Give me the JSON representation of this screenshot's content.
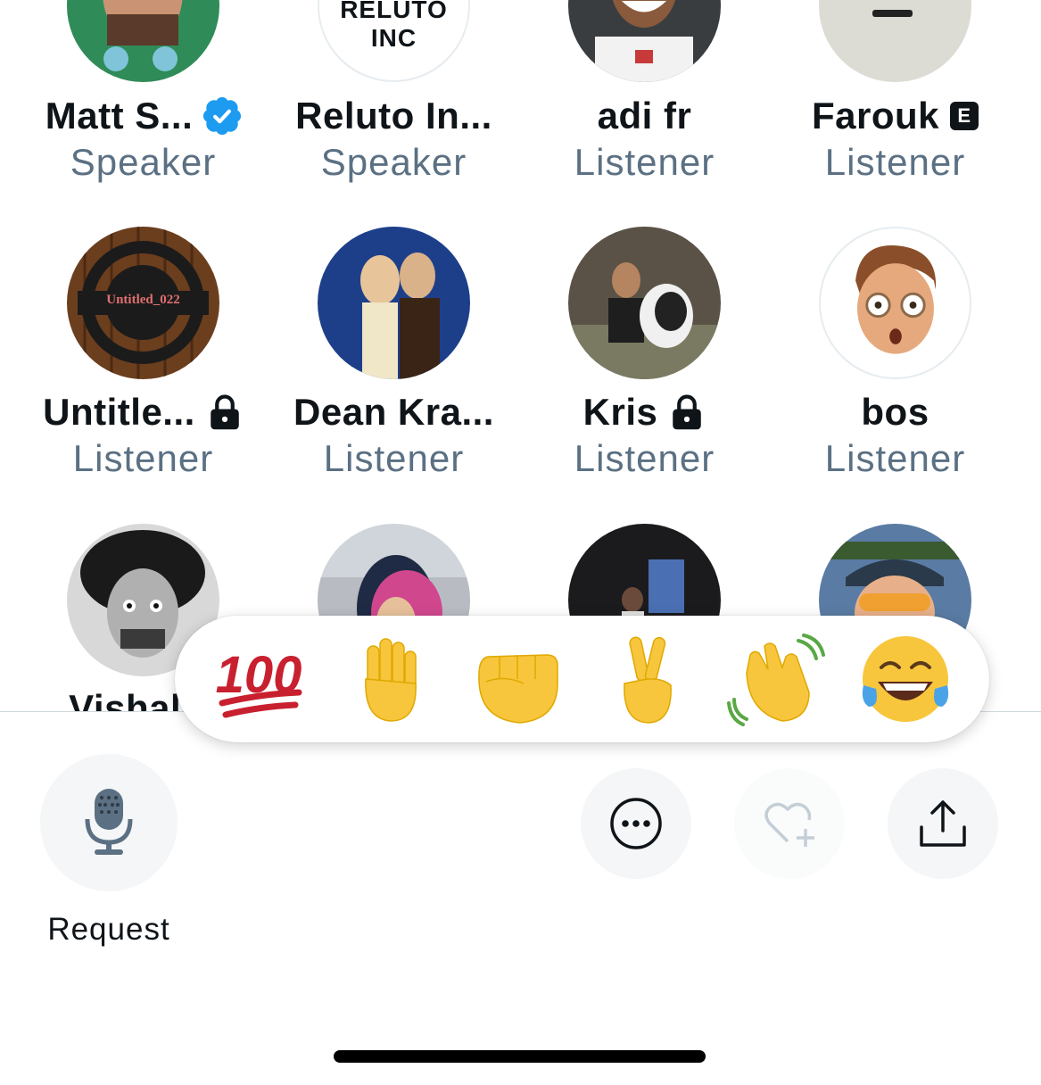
{
  "participants": [
    {
      "name": "Matt S...",
      "role": "Speaker",
      "badge": "verified-icon",
      "avatar_color": "#2f8b57"
    },
    {
      "name": "Reluto In...",
      "role": "Speaker",
      "badge": "",
      "avatar_text": "RELUTO INC",
      "avatar_color": "#ffffff"
    },
    {
      "name": "adi fr",
      "role": "Listener",
      "badge": "",
      "avatar_color": "#3a3d40"
    },
    {
      "name": "Farouk",
      "role": "Listener",
      "badge": "e-badge-icon",
      "badge_text": "E",
      "avatar_color": "#dcdcd4"
    },
    {
      "name": "Untitle...",
      "role": "Listener",
      "badge": "lock-icon",
      "avatar_text": "Untitled_022",
      "avatar_color": "#6b3e1e"
    },
    {
      "name": "Dean Kra...",
      "role": "Listener",
      "badge": "",
      "avatar_color": "#1d3f8a"
    },
    {
      "name": "Kris",
      "role": "Listener",
      "badge": "lock-icon",
      "avatar_color": "#5a5246"
    },
    {
      "name": "bos",
      "role": "Listener",
      "badge": "",
      "avatar_color": "#ffffff"
    },
    {
      "name": "Vishal S",
      "role": "",
      "badge": "",
      "avatar_color": "#9a9a9a"
    },
    {
      "name": "",
      "role": "",
      "badge": "",
      "avatar_color": "#b8bcc2"
    },
    {
      "name": "",
      "role": "",
      "badge": "",
      "avatar_color": "#1b1b1e"
    },
    {
      "name": "",
      "role": "",
      "badge": "",
      "avatar_color": "#5a7ba3"
    }
  ],
  "reactions": [
    {
      "icon": "hundred-points-icon"
    },
    {
      "icon": "raised-hand-icon"
    },
    {
      "icon": "raised-fist-icon"
    },
    {
      "icon": "victory-hand-icon"
    },
    {
      "icon": "waving-hand-icon"
    },
    {
      "icon": "tears-of-joy-icon"
    }
  ],
  "controls": {
    "request_label": "Request",
    "mic_icon": "microphone-icon",
    "more_icon": "more-icon",
    "heart_icon": "heart-plus-icon",
    "share_icon": "share-icon"
  },
  "colors": {
    "accent": "#1d9bf0",
    "role_text": "#5b7083",
    "emoji_yellow": "#f7c63c",
    "hundred_red": "#c8202f"
  }
}
